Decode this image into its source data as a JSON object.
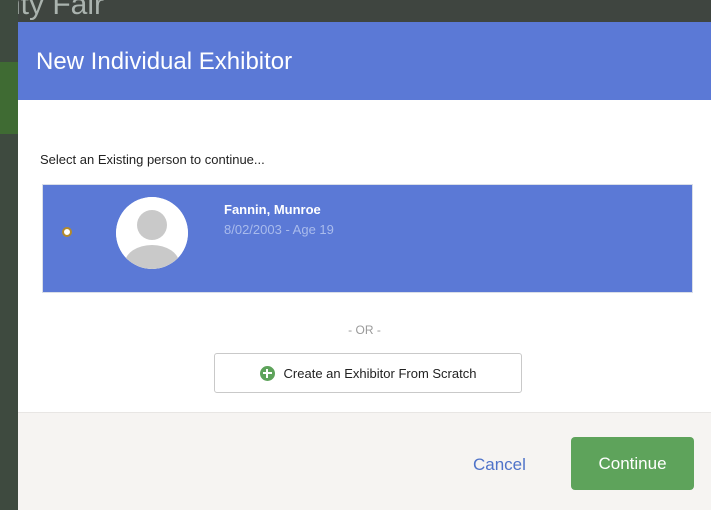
{
  "backdrop": {
    "page_title_fragment": "nty Fair"
  },
  "modal": {
    "title": "New Individual Exhibitor",
    "instruction": "Select an Existing person to continue...",
    "people": [
      {
        "name": "Fannin, Munroe",
        "meta": "8/02/2003 - Age 19",
        "selected": false
      }
    ],
    "separator": "- OR -",
    "create_button_label": "Create an Exhibitor From Scratch",
    "cancel_label": "Cancel",
    "continue_label": "Continue"
  },
  "colors": {
    "header_blue": "#5b79d6",
    "selected_card_blue": "#5b79d6",
    "continue_green": "#5ea35b",
    "cancel_link": "#4f73c9"
  },
  "icons": [
    "plus-circle-icon",
    "user-avatar-icon",
    "radio-icon"
  ]
}
